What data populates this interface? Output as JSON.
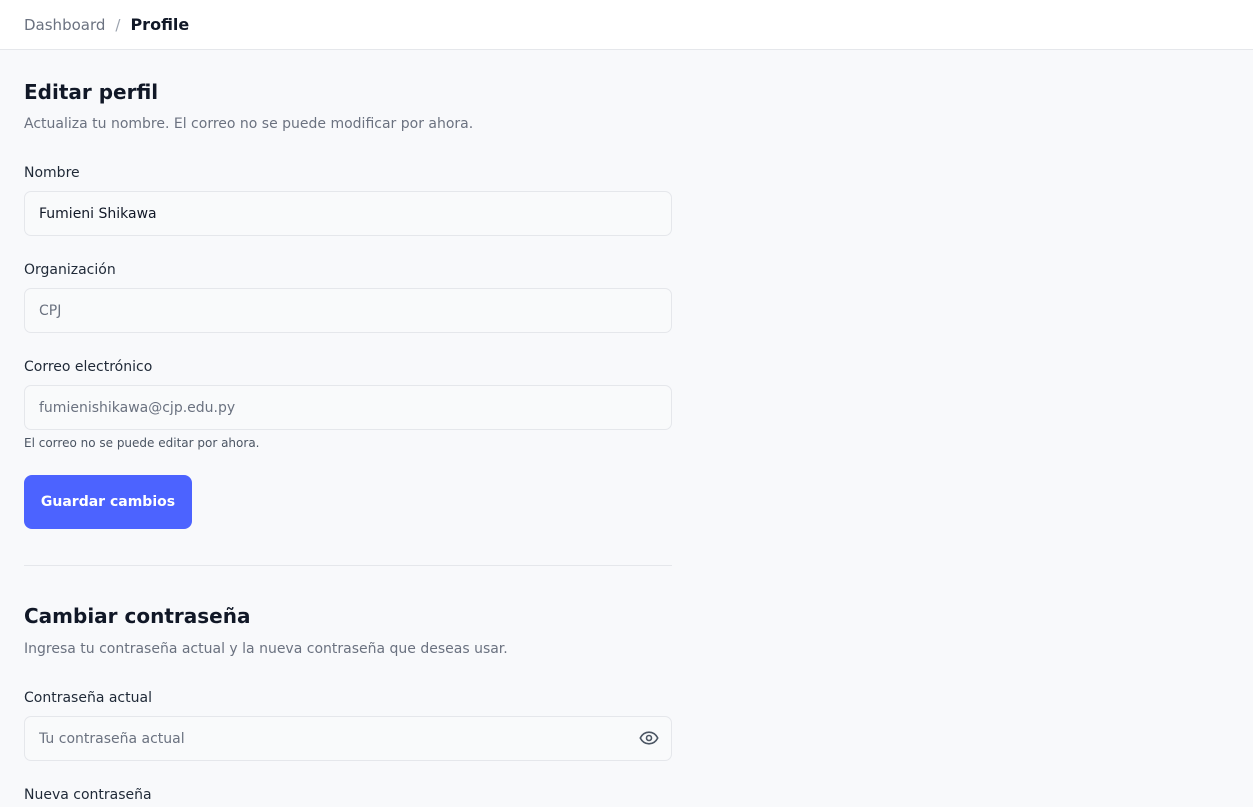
{
  "breadcrumb": {
    "parent": "Dashboard",
    "separator": "/",
    "current": "Profile"
  },
  "edit_profile": {
    "title": "Editar perfil",
    "description": "Actualiza tu nombre. El correo no se puede modificar por ahora.",
    "name_label": "Nombre",
    "name_value": "Fumieni Shikawa",
    "org_label": "Organización",
    "org_value": "CPJ",
    "email_label": "Correo electrónico",
    "email_value": "fumienishikawa@cjp.edu.py",
    "email_help": "El correo no se puede editar por ahora.",
    "save_label": "Guardar cambios"
  },
  "change_password": {
    "title": "Cambiar contraseña",
    "description": "Ingresa tu contraseña actual y la nueva contraseña que deseas usar.",
    "current_label": "Contraseña actual",
    "current_placeholder": "Tu contraseña actual",
    "new_label": "Nueva contraseña"
  },
  "icons": {
    "toggle_visibility": "eye-icon"
  },
  "colors": {
    "primary": "#4c63ff",
    "background": "#f8f9fb",
    "border": "#e5e7eb"
  }
}
